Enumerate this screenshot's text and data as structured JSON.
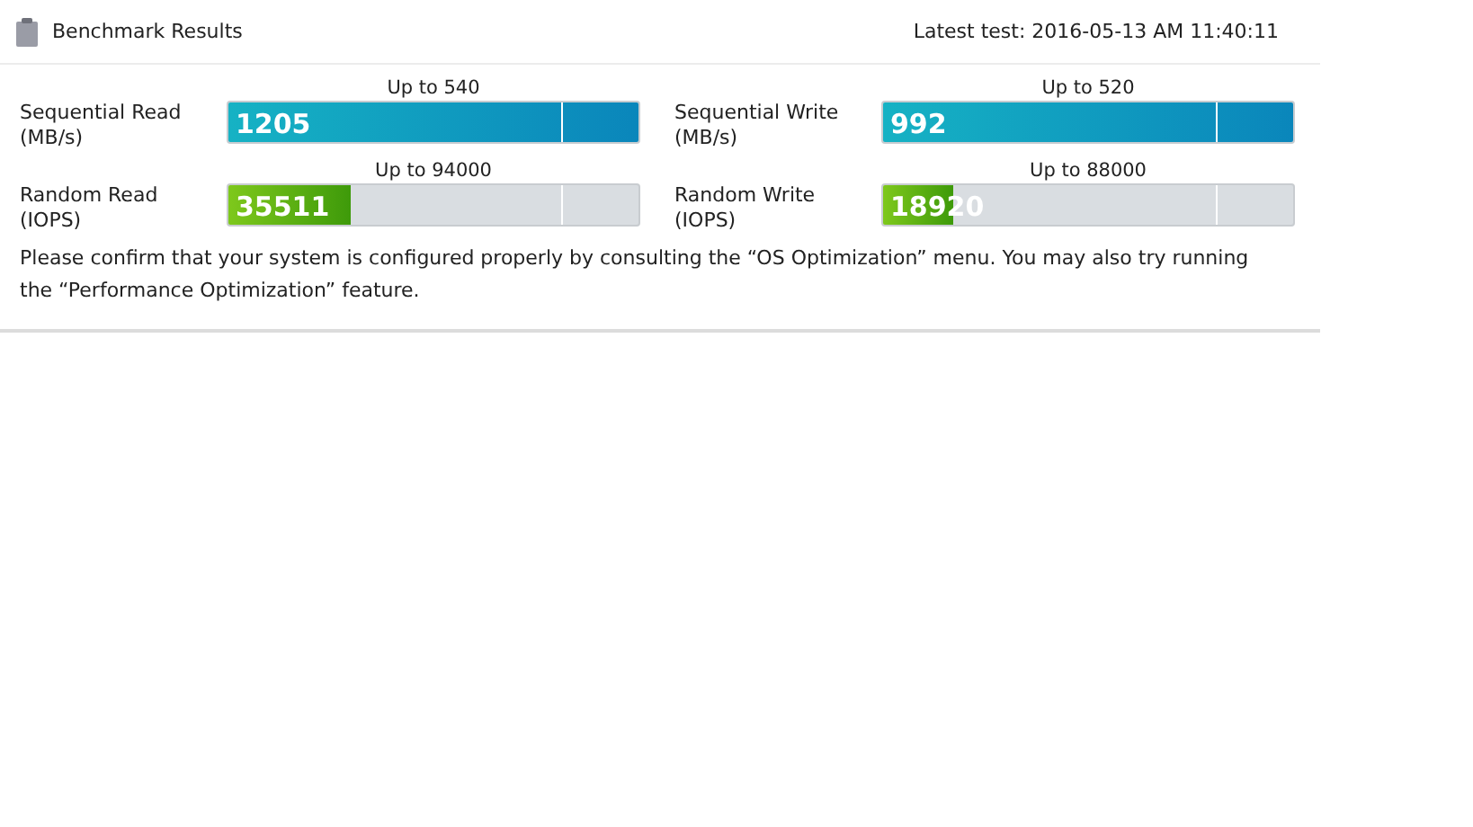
{
  "header": {
    "title": "Benchmark Results",
    "latest_test": "Latest test: 2016-05-13 AM 11:40:11"
  },
  "metrics": [
    {
      "name": "Sequential Read",
      "unit": "(MB/s)",
      "cap": "Up to 540",
      "value": "1205",
      "level": 1.0,
      "kind": "throughput"
    },
    {
      "name": "Sequential Write",
      "unit": "(MB/s)",
      "cap": "Up to 520",
      "value": "992",
      "level": 1.0,
      "kind": "throughput"
    },
    {
      "name": "Random Read",
      "unit": "(IOPS)",
      "cap": "Up to 94000",
      "value": "35511",
      "level": 0.3,
      "kind": "iops"
    },
    {
      "name": "Random Write",
      "unit": "(IOPS)",
      "cap": "Up to 88000",
      "value": "18920",
      "level": 0.17,
      "kind": "iops"
    }
  ],
  "note": "Please confirm that your system is configured properly by consulting the “OS Optimization” menu. You may also try running the “Performance Optimization” feature."
}
